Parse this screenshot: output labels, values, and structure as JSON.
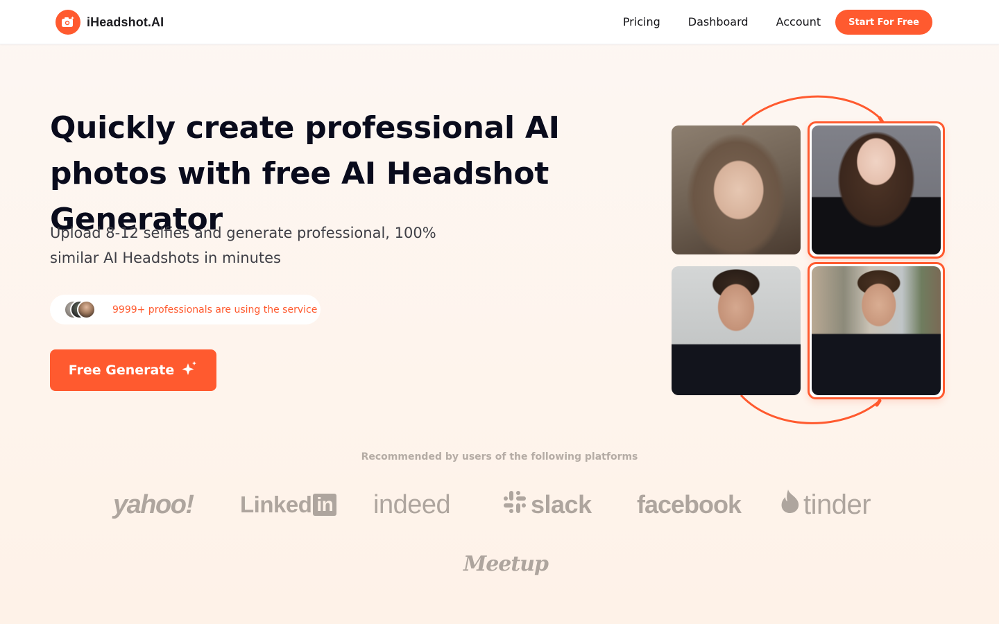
{
  "header": {
    "brand": "iHeadshot.AI",
    "brand_icon": "camera-sparkle-icon",
    "nav": [
      {
        "label": "Pricing"
      },
      {
        "label": "Dashboard"
      },
      {
        "label": "Account"
      }
    ],
    "cta_label": "Start For Free"
  },
  "hero": {
    "title": "Quickly create professional AI photos with free AI Headshot Generator",
    "subtitle": "Upload 8-12 selfies and generate professional, 100% similar AI Headshots in minutes",
    "social_proof": "9999+ professionals are using the service",
    "generate_label": "Free Generate",
    "generate_icon": "sparkle-icon"
  },
  "showcase": {
    "photos": [
      {
        "label": "Woman selfie (before)",
        "kind": "original"
      },
      {
        "label": "Woman professional headshot (after)",
        "kind": "generated"
      },
      {
        "label": "Man selfie (before)",
        "kind": "original"
      },
      {
        "label": "Man professional headshot (after)",
        "kind": "generated"
      }
    ]
  },
  "platforms": {
    "heading": "Recommended by users of the following platforms",
    "logos": [
      {
        "name": "yahoo!"
      },
      {
        "name": "Linked",
        "suffix": "in"
      },
      {
        "name": "indeed"
      },
      {
        "name": "slack"
      },
      {
        "name": "facebook"
      },
      {
        "name": "tinder"
      },
      {
        "name": "Meetup"
      }
    ]
  },
  "colors": {
    "accent": "#ff5a2f",
    "heading": "#090b1c",
    "muted_logo": "#aea59e",
    "background": "#fdf6f0"
  }
}
